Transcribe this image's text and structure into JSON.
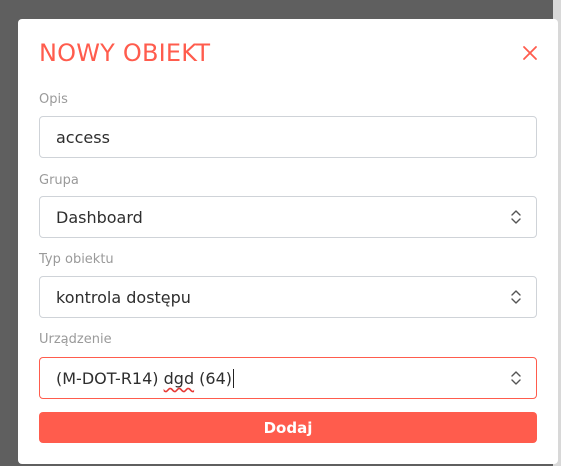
{
  "modal": {
    "title": "NOWY OBIEKT",
    "close_icon": "close-icon",
    "accent_color": "#ff5c4d"
  },
  "form": {
    "opis": {
      "label": "Opis",
      "value": "access"
    },
    "grupa": {
      "label": "Grupa",
      "value": "Dashboard",
      "icon": "select-arrows-icon"
    },
    "typ_obiektu": {
      "label": "Typ obiektu",
      "value": "kontrola dostępu",
      "icon": "select-arrows-icon"
    },
    "urzadzenie": {
      "label": "Urządzenie",
      "value_prefix": "(M-DOT-R14) ",
      "value_misspelled": "dgd",
      "value_suffix": " (64)",
      "icon": "select-arrows-icon"
    }
  },
  "actions": {
    "submit_label": "Dodaj"
  }
}
